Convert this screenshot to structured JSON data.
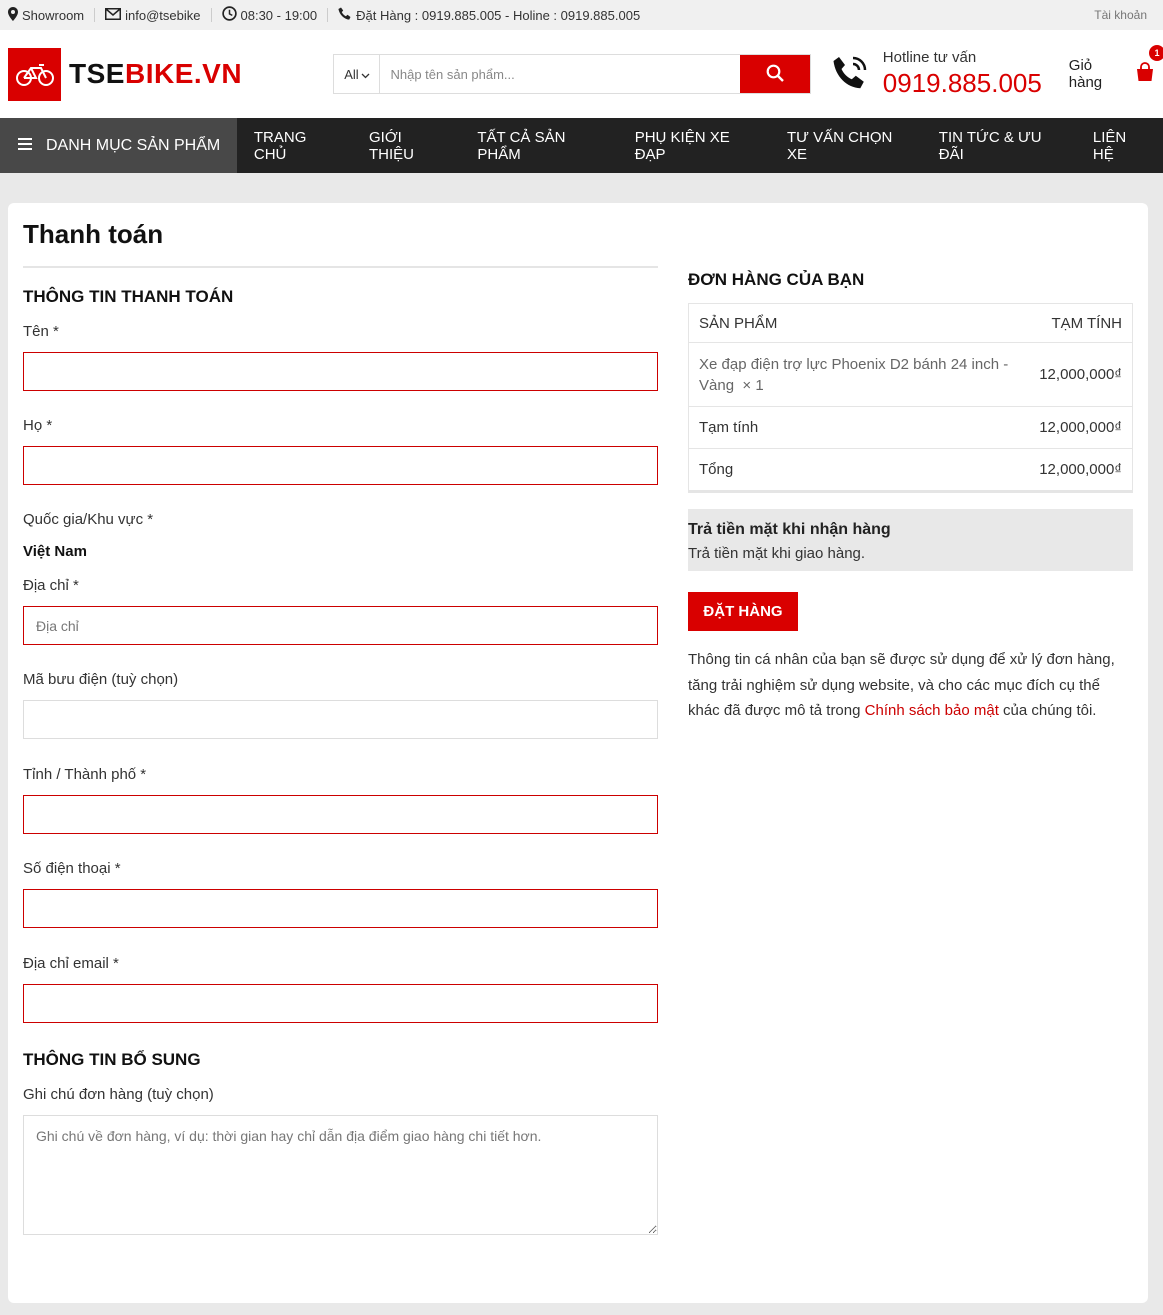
{
  "topbar": {
    "showroom": "Showroom",
    "email": "info@tsebike",
    "hours": "08:30 - 19:00",
    "phones": "Đặt Hàng : 0919.885.005 - Holine : 0919.885.005",
    "account": "Tài khoản"
  },
  "header": {
    "logo_a": "TSE",
    "logo_b": "BIKE.VN",
    "search_category": "All",
    "search_placeholder": "Nhập tên sản phẩm...",
    "hotline_label": "Hotline tư vấn",
    "hotline_number": "0919.885.005",
    "cart_label": "Giỏ hàng",
    "cart_count": "1"
  },
  "nav": {
    "category_button": "Danh mục sản phẩm",
    "links": [
      "Trang chủ",
      "Giới thiệu",
      "Tất cả sản phẩm",
      "Phụ kiện xe đạp",
      "Tư vấn chọn xe",
      "Tin tức & ưu đãi",
      "Liên hệ"
    ]
  },
  "checkout": {
    "title": "Thanh toán",
    "billing_heading": "Thông tin thanh toán",
    "first_name_label": "Tên *",
    "last_name_label": "Họ *",
    "country_label": "Quốc gia/Khu vực *",
    "country_value": "Việt Nam",
    "address_label": "Địa chỉ *",
    "address_placeholder": "Địa chỉ",
    "postcode_label": "Mã bưu điện (tuỳ chọn)",
    "city_label": "Tỉnh / Thành phố *",
    "phone_label": "Số điện thoại *",
    "email_label": "Địa chỉ email *",
    "additional_heading": "Thông tin bổ sung",
    "notes_label": "Ghi chú đơn hàng (tuỳ chọn)",
    "notes_placeholder": "Ghi chú về đơn hàng, ví dụ: thời gian hay chỉ dẫn địa điểm giao hàng chi tiết hơn."
  },
  "order": {
    "heading": "Đơn hàng của bạn",
    "col_product": "Sản phẩm",
    "col_subtotal": "Tạm tính",
    "product_name": "Xe đạp điện trợ lực Phoenix D2 bánh 24 inch - Vàng",
    "product_qty": "× 1",
    "product_price": "12,000,000₫",
    "subtotal_label": "Tạm tính",
    "subtotal_value": "12,000,000₫",
    "total_label": "Tổng",
    "total_value": "12,000,000₫",
    "payment_title": "Trả tiền mặt khi nhận hàng",
    "payment_desc": "Trả tiền mặt khi giao hàng.",
    "place_order": "Đặt hàng",
    "privacy_pre": "Thông tin cá nhân của bạn sẽ được sử dụng để xử lý đơn hàng, tăng trải nghiệm sử dụng website, và cho các mục đích cụ thể khác đã được mô tả trong ",
    "privacy_link": "Chính sách bảo mật",
    "privacy_post": " của chúng tôi."
  },
  "colors": {
    "brand_red": "#d90000",
    "nav_dark": "#222222"
  }
}
